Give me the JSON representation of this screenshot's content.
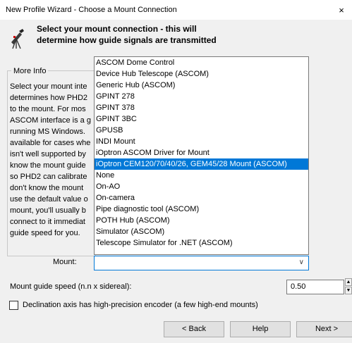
{
  "window": {
    "title": "New Profile Wizard - Choose a Mount Connection",
    "close_glyph": "×"
  },
  "header": {
    "instruction": "Select your mount connection - this will determine how guide signals are transmitted"
  },
  "info": {
    "legend": "More Info",
    "text": "Select your mount inte\ndetermines how PHD2\nto the mount. For mos\nASCOM interface is a g\nrunning MS Windows.\navailable for cases whe\nisn't well supported by\nknow the mount guide\nso PHD2 can calibrate\ndon't know the mount\nuse the default value o\nmount, you'll usually b\nconnect to it immediat\nguide speed for you."
  },
  "mount_dropdown": {
    "items": [
      "ASCOM Dome Control",
      "Device Hub Telescope (ASCOM)",
      "Generic Hub (ASCOM)",
      "GPINT 278",
      "GPINT 378",
      "GPINT 3BC",
      "GPUSB",
      "INDI Mount",
      "iOptron ASCOM Driver for Mount",
      "iOptron CEM120/70/40/26, GEM45/28 Mount (ASCOM)",
      "None",
      "On-AO",
      "On-camera",
      "Pipe diagnostic tool (ASCOM)",
      "POTH Hub (ASCOM)",
      "Simulator (ASCOM)",
      "Telescope Simulator for .NET (ASCOM)"
    ],
    "highlighted": "iOptron CEM120/70/40/26, GEM45/28 Mount (ASCOM)"
  },
  "mount": {
    "label": "Mount:",
    "value": "",
    "chevron": "∨"
  },
  "guide_speed": {
    "label": "Mount guide speed (n.n x sidereal):",
    "value": "0.50"
  },
  "encoder": {
    "label": "Declination axis has high-precision encoder (a few high-end mounts)",
    "checked": false
  },
  "buttons": {
    "back": "< Back",
    "help": "Help",
    "next": "Next >"
  },
  "colors": {
    "selection": "#0078d7",
    "focus_border": "#0078d7"
  }
}
